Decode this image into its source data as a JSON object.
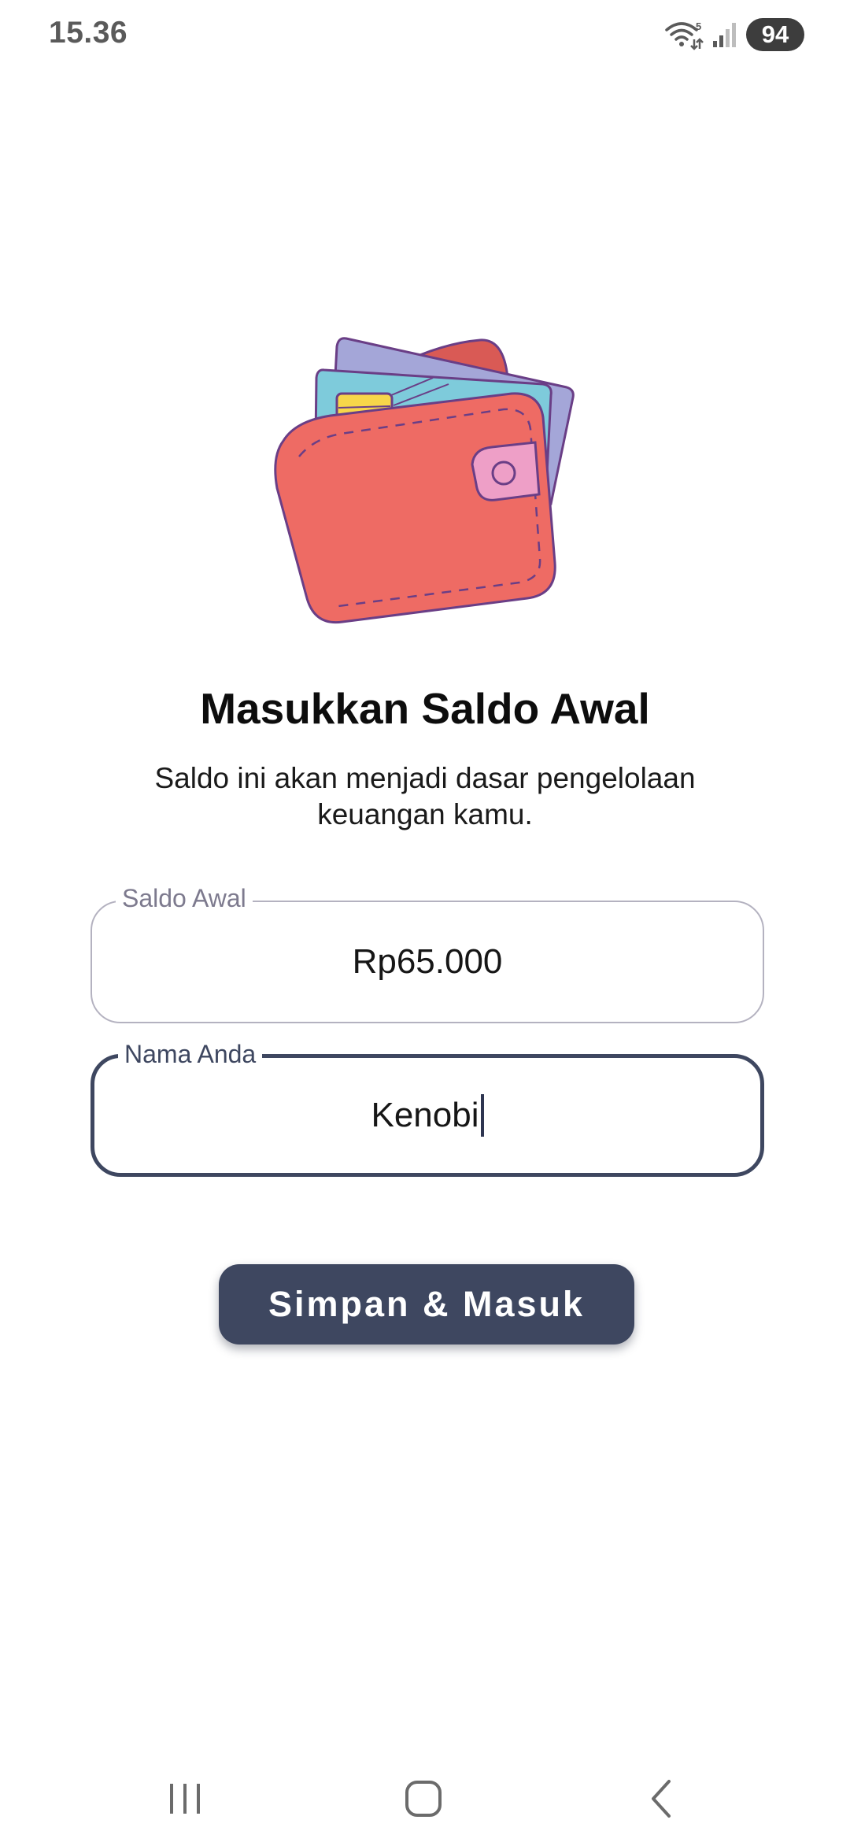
{
  "status_bar": {
    "time": "15.36",
    "wifi_badge": "5",
    "battery": "94",
    "icons": [
      "wifi-icon",
      "signal-icon",
      "battery-icon"
    ]
  },
  "illustration": {
    "icon": "wallet-icon",
    "colors": {
      "wallet": "#ee6b64",
      "wallet_back": "#d95a55",
      "card_blue": "#7ecbdb",
      "card_purple": "#a4a6d8",
      "chip": "#f7d64a",
      "clasp": "#ee9fc7",
      "outline": "#6a3e86"
    }
  },
  "main": {
    "title": "Masukkan Saldo Awal",
    "subtitle": "Saldo ini akan menjadi dasar pengelolaan keuangan kamu."
  },
  "form": {
    "saldo": {
      "label": "Saldo Awal",
      "value": "Rp65.000"
    },
    "nama": {
      "label": "Nama Anda",
      "value": "Kenobi"
    },
    "submit_label": "Simpan & Masuk"
  },
  "nav_bar": {
    "icons": [
      "recents-icon",
      "home-icon",
      "back-icon"
    ]
  },
  "colors": {
    "accent": "#3e4760",
    "field_border_inactive": "#b4b2c0",
    "background": "#ffffff"
  }
}
